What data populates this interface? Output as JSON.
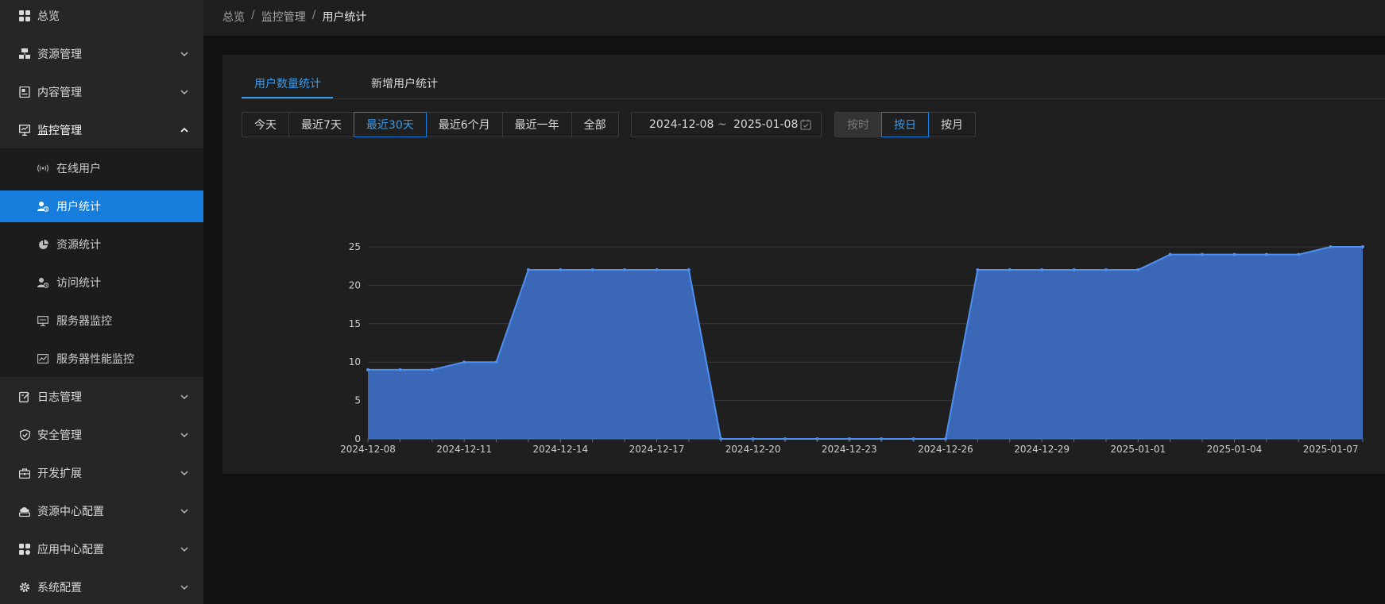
{
  "sidebar": {
    "items": [
      {
        "label": "总览",
        "icon": "dashboard-icon",
        "expandable": false
      },
      {
        "label": "资源管理",
        "icon": "resource-icon",
        "expandable": true
      },
      {
        "label": "内容管理",
        "icon": "content-icon",
        "expandable": true
      },
      {
        "label": "监控管理",
        "icon": "monitor-icon",
        "expandable": true,
        "expanded": true
      },
      {
        "label": "日志管理",
        "icon": "log-icon",
        "expandable": true
      },
      {
        "label": "安全管理",
        "icon": "shield-icon",
        "expandable": true
      },
      {
        "label": "开发扩展",
        "icon": "toolbox-icon",
        "expandable": true
      },
      {
        "label": "资源中心配置",
        "icon": "cloud-config-icon",
        "expandable": true
      },
      {
        "label": "应用中心配置",
        "icon": "apps-icon",
        "expandable": true
      },
      {
        "label": "系统配置",
        "icon": "gear-icon",
        "expandable": true
      }
    ],
    "monitor_submenu": [
      {
        "label": "在线用户",
        "icon": "broadcast-icon"
      },
      {
        "label": "用户统计",
        "icon": "user-stats-icon",
        "active": true
      },
      {
        "label": "资源统计",
        "icon": "pie-chart-icon"
      },
      {
        "label": "访问统计",
        "icon": "user-clock-icon"
      },
      {
        "label": "服务器监控",
        "icon": "desktop-icon"
      },
      {
        "label": "服务器性能监控",
        "icon": "line-chart-icon"
      }
    ]
  },
  "breadcrumb": [
    "总览",
    "监控管理",
    "用户统计"
  ],
  "breadcrumb_sep": "/",
  "tabs": [
    {
      "label": "用户数量统计",
      "active": true
    },
    {
      "label": "新增用户统计",
      "active": false
    }
  ],
  "range_buttons": [
    {
      "label": "今天"
    },
    {
      "label": "最近7天"
    },
    {
      "label": "最近30天",
      "active": true
    },
    {
      "label": "最近6个月"
    },
    {
      "label": "最近一年"
    },
    {
      "label": "全部"
    }
  ],
  "date_range": {
    "start": "2024-12-08",
    "separator": "~",
    "end": "2025-01-08"
  },
  "granularity_buttons": [
    {
      "label": "按时",
      "disabled": true
    },
    {
      "label": "按日",
      "active": true
    },
    {
      "label": "按月"
    }
  ],
  "colors": {
    "accent": "#177ddc",
    "series": "#4f8ff0",
    "area": "#3d6fc4"
  },
  "chart_data": {
    "type": "area",
    "x": [
      "2024-12-08",
      "2024-12-09",
      "2024-12-10",
      "2024-12-11",
      "2024-12-12",
      "2024-12-13",
      "2024-12-14",
      "2024-12-15",
      "2024-12-16",
      "2024-12-17",
      "2024-12-18",
      "2024-12-19",
      "2024-12-20",
      "2024-12-21",
      "2024-12-22",
      "2024-12-23",
      "2024-12-24",
      "2024-12-25",
      "2024-12-26",
      "2024-12-27",
      "2024-12-28",
      "2024-12-29",
      "2024-12-30",
      "2024-12-31",
      "2025-01-01",
      "2025-01-02",
      "2025-01-03",
      "2025-01-04",
      "2025-01-05",
      "2025-01-06",
      "2025-01-07",
      "2025-01-08"
    ],
    "x_tick_labels": [
      "2024-12-08",
      "2024-12-11",
      "2024-12-14",
      "2024-12-17",
      "2024-12-20",
      "2024-12-23",
      "2024-12-26",
      "2024-12-29",
      "2025-01-01",
      "2025-01-04",
      "2025-01-07"
    ],
    "series": [
      {
        "name": "用户数量",
        "values": [
          9,
          9,
          9,
          10,
          10,
          22,
          22,
          22,
          22,
          22,
          22,
          0,
          0,
          0,
          0,
          0,
          0,
          0,
          0,
          22,
          22,
          22,
          22,
          22,
          22,
          24,
          24,
          24,
          24,
          24,
          25,
          25
        ]
      }
    ],
    "y_ticks": [
      0,
      5,
      10,
      15,
      20,
      25
    ],
    "ylim": [
      0,
      25
    ],
    "grid": true,
    "legend": "bottom-center"
  }
}
